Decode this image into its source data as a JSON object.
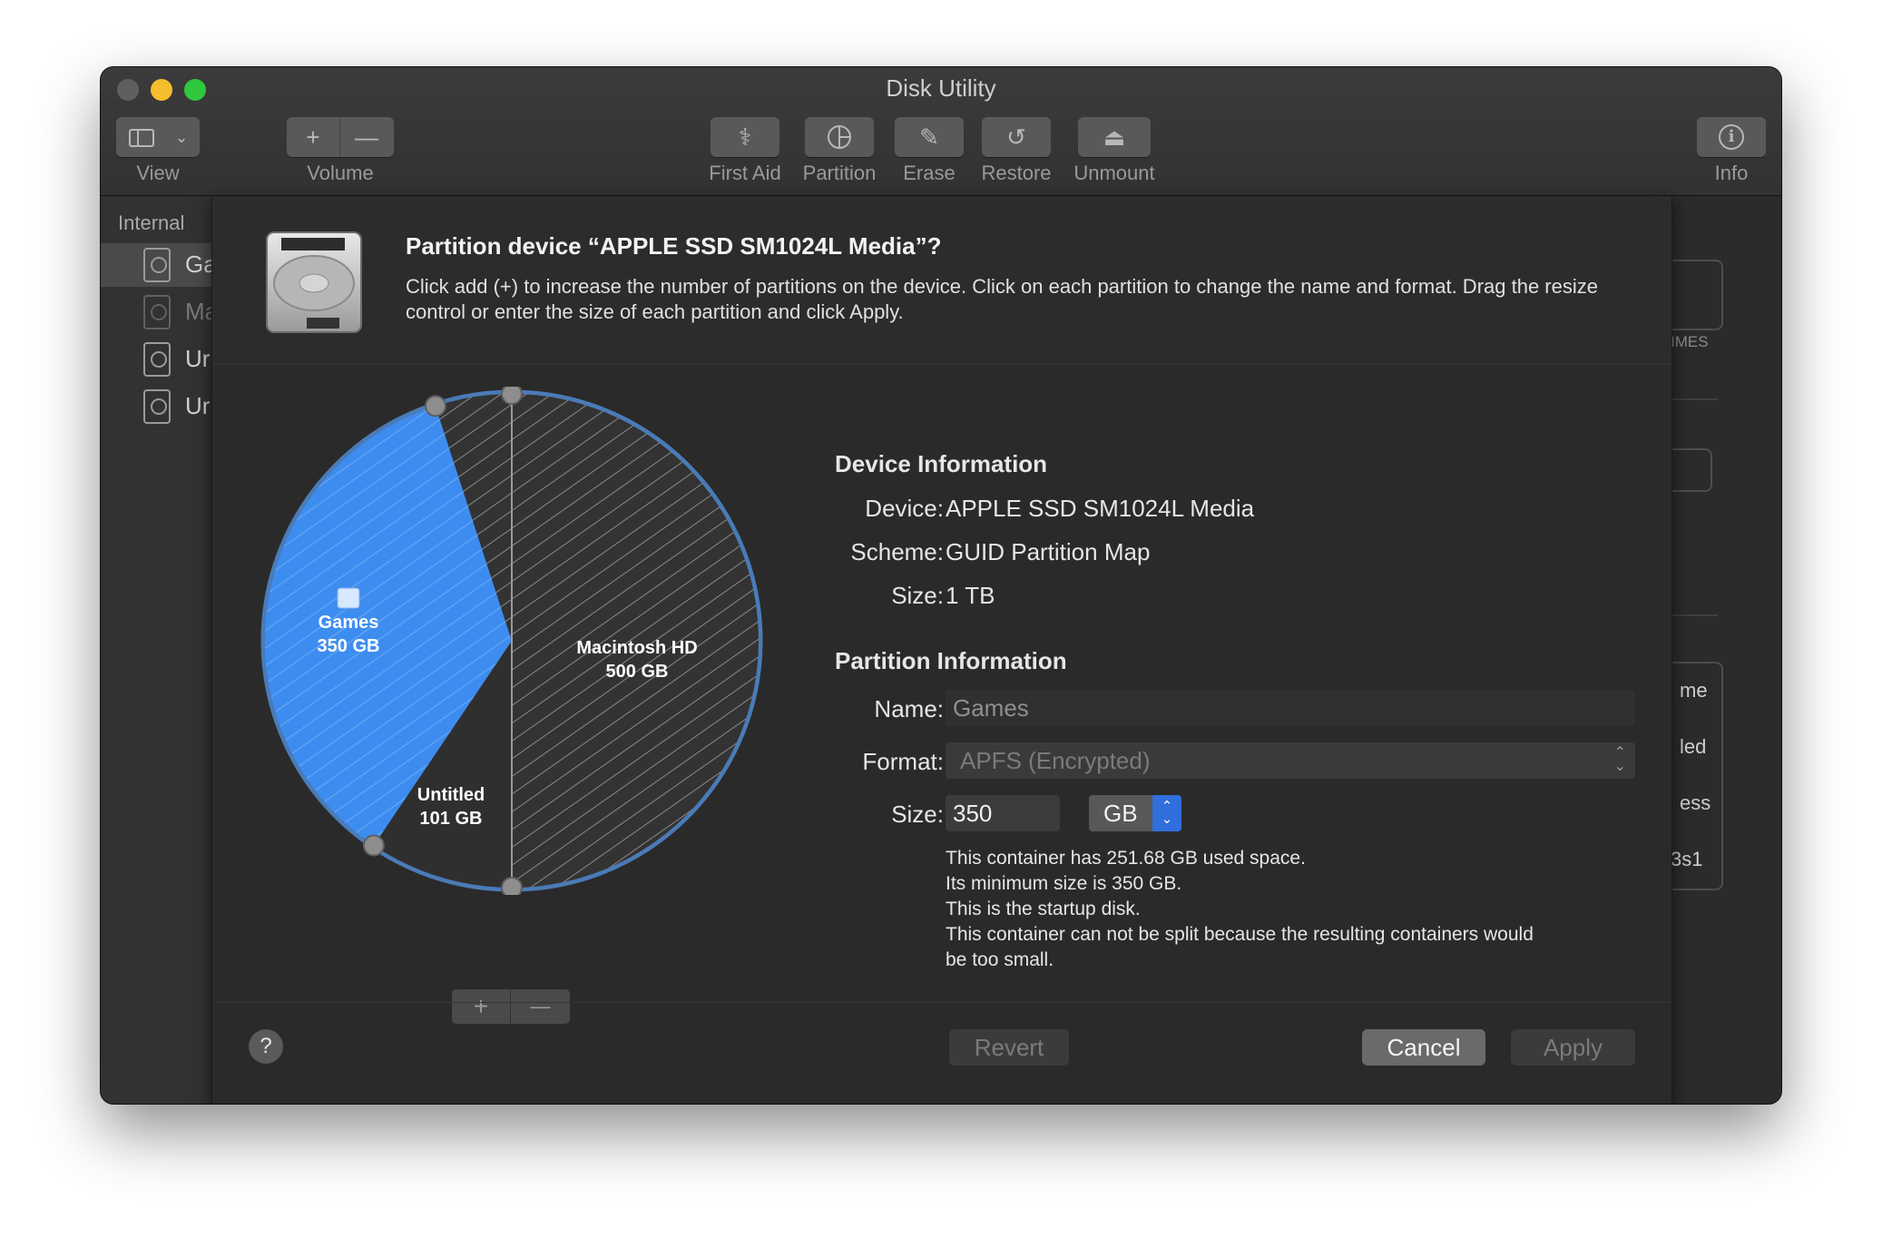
{
  "window": {
    "title": "Disk Utility"
  },
  "toolbar": {
    "view_label": "View",
    "volume_label": "Volume",
    "first_aid_label": "First Aid",
    "partition_label": "Partition",
    "erase_label": "Erase",
    "restore_label": "Restore",
    "unmount_label": "Unmount",
    "info_label": "Info"
  },
  "sidebar": {
    "section": "Internal",
    "items": [
      {
        "label": "Ga"
      },
      {
        "label": "Ma"
      },
      {
        "label": "Ur"
      },
      {
        "label": "Ur"
      }
    ]
  },
  "background_panel": {
    "times_text": "IMES",
    "row1": "me",
    "row2": "led",
    "row3": "ess",
    "row4": "3s1"
  },
  "sheet": {
    "title": "Partition device “APPLE SSD SM1024L Media”?",
    "description": "Click add (+) to increase the number of partitions on the device. Click on each partition to change the name and format. Drag the resize control or enter the size of each partition and click Apply."
  },
  "pie": {
    "slices": [
      {
        "name": "Games",
        "size": "350 GB",
        "value_gb": 350,
        "color": "#3d8cf0"
      },
      {
        "name": "Macintosh HD",
        "size": "500 GB",
        "value_gb": 500,
        "color": "#3a3a3a"
      },
      {
        "name": "Untitled",
        "size": "101 GB",
        "value_gb": 101,
        "color": "#2f2f2f"
      }
    ],
    "add_symbol": "+",
    "remove_symbol": "—"
  },
  "device_info": {
    "heading": "Device Information",
    "device_label": "Device:",
    "device_value": "APPLE SSD SM1024L Media",
    "scheme_label": "Scheme:",
    "scheme_value": "GUID Partition Map",
    "size_label": "Size:",
    "size_value": "1 TB"
  },
  "partition_info": {
    "heading": "Partition Information",
    "name_label": "Name:",
    "name_value": "Games",
    "format_label": "Format:",
    "format_value": "APFS (Encrypted)",
    "size_label": "Size:",
    "size_value": "350",
    "unit_value": "GB",
    "notes": [
      "This container has 251.68 GB used space.",
      "Its minimum size is 350 GB.",
      "This is the startup disk.",
      "This container can not be split because the resulting containers would",
      "be too small."
    ]
  },
  "buttons": {
    "help": "?",
    "revert": "Revert",
    "cancel": "Cancel",
    "apply": "Apply"
  },
  "colors": {
    "accent": "#3d8cf0",
    "close": "#5f5f5f",
    "minimize": "#f5be2e",
    "zoom": "#2fc73d"
  }
}
